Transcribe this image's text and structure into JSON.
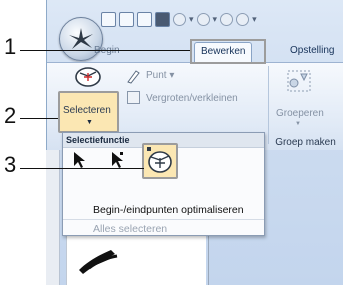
{
  "callouts": [
    "1",
    "2",
    "3"
  ],
  "ribbon": {
    "tabs": [
      "Begin",
      "Bewerken",
      "Opstelling"
    ],
    "buttons": {
      "punt": "Punt",
      "vergroten": "Vergroten/verkleinen",
      "selecteren": "Selecteren",
      "groeperen": "Groeperen",
      "groep_maken": "Groep maken"
    }
  },
  "dropdown": {
    "title": "Selectiefunctie",
    "items": [
      "Begin-/eindpunten optimaliseren",
      "Alles selecteren"
    ]
  },
  "colors": {
    "highlight": "#fbe7b3",
    "ribbon_bg": "#dce7f5"
  }
}
